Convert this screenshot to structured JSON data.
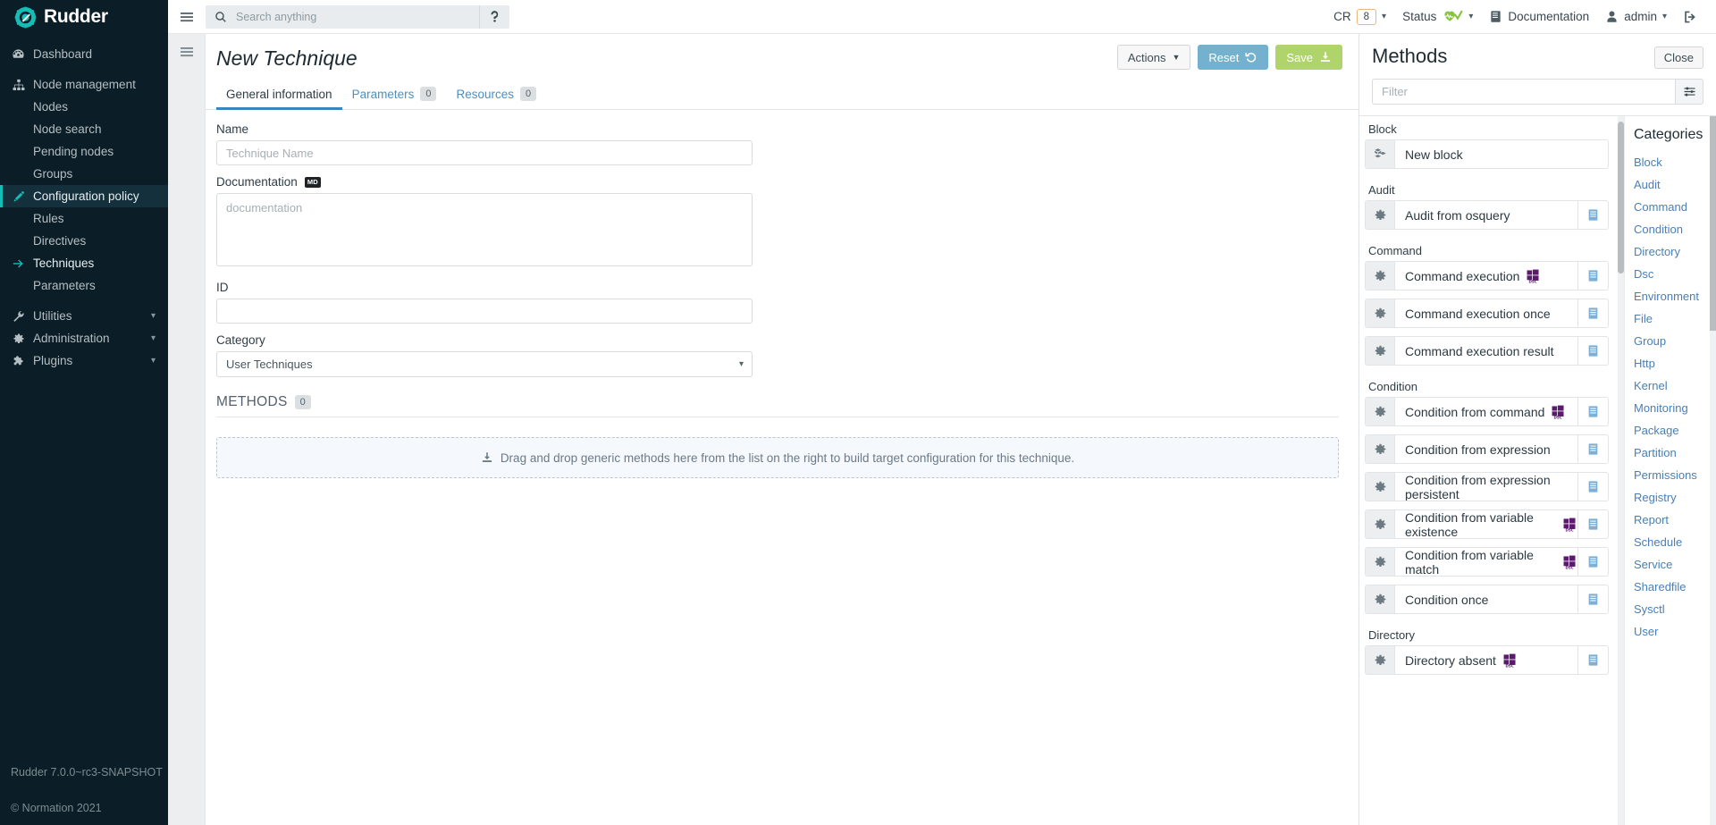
{
  "brand": {
    "name": "Rudder",
    "logo_color": "#13beb7"
  },
  "sidebar": {
    "groups": [
      {
        "label": "Dashboard",
        "icon": "dashboard-icon",
        "type": "top"
      },
      {
        "label": "Node management",
        "icon": "sitemap-icon",
        "type": "top"
      },
      {
        "label": "Nodes",
        "type": "sub"
      },
      {
        "label": "Node search",
        "type": "sub"
      },
      {
        "label": "Pending nodes",
        "type": "sub"
      },
      {
        "label": "Groups",
        "type": "sub"
      },
      {
        "label": "Configuration policy",
        "icon": "pencil-icon",
        "type": "top",
        "active": true
      },
      {
        "label": "Rules",
        "type": "sub"
      },
      {
        "label": "Directives",
        "type": "sub"
      },
      {
        "label": "Techniques",
        "type": "sub",
        "current": true,
        "icon": "arrow-right-icon"
      },
      {
        "label": "Parameters",
        "type": "sub"
      },
      {
        "label": "Utilities",
        "icon": "wrench-icon",
        "type": "top",
        "chevron": "⌄"
      },
      {
        "label": "Administration",
        "icon": "gear-icon",
        "type": "top",
        "chevron": "⌄"
      },
      {
        "label": "Plugins",
        "icon": "puzzle-icon",
        "type": "top",
        "chevron": "⌄"
      }
    ],
    "footer": {
      "version": "Rudder 7.0.0~rc3-SNAPSHOT",
      "copyright": "© Normation 2021"
    }
  },
  "topbar": {
    "search_placeholder": "Search anything",
    "search_value": "",
    "cr_label": "CR",
    "cr_count": "8",
    "status_label": "Status",
    "documentation_label": "Documentation",
    "user_label": "admin"
  },
  "page": {
    "title": "New Technique",
    "buttons": {
      "actions": "Actions",
      "reset": "Reset",
      "save": "Save"
    },
    "tabs": [
      {
        "label": "General information",
        "count": null,
        "active": true
      },
      {
        "label": "Parameters",
        "count": "0",
        "active": false
      },
      {
        "label": "Resources",
        "count": "0",
        "active": false
      }
    ],
    "form": {
      "name_label": "Name",
      "name_placeholder": "Technique Name",
      "name_value": "",
      "documentation_label": "Documentation",
      "documentation_badge": "MD",
      "documentation_placeholder": "documentation",
      "documentation_value": "",
      "id_label": "ID",
      "id_placeholder": "",
      "id_value": "",
      "category_label": "Category",
      "category_value": "User Techniques"
    },
    "methods_section": {
      "title": "METHODS",
      "count": "0",
      "dropzone_text": "Drag and drop generic methods here from the list on the right to build target configuration for this technique."
    }
  },
  "methods_panel": {
    "title": "Methods",
    "close_label": "Close",
    "filter_placeholder": "Filter",
    "filter_value": "",
    "groups": [
      {
        "category": "Block",
        "items": [
          {
            "name": "New block",
            "icon": "blocks-icon",
            "dsc": false,
            "doc": false
          }
        ]
      },
      {
        "category": "Audit",
        "items": [
          {
            "name": "Audit from osquery",
            "icon": "gear-icon",
            "dsc": false,
            "doc": true
          }
        ]
      },
      {
        "category": "Command",
        "items": [
          {
            "name": "Command execution",
            "icon": "gear-icon",
            "dsc": true,
            "doc": true
          },
          {
            "name": "Command execution once",
            "icon": "gear-icon",
            "dsc": false,
            "doc": true
          },
          {
            "name": "Command execution result",
            "icon": "gear-icon",
            "dsc": false,
            "doc": true
          }
        ]
      },
      {
        "category": "Condition",
        "items": [
          {
            "name": "Condition from command",
            "icon": "gear-icon",
            "dsc": true,
            "doc": true
          },
          {
            "name": "Condition from expression",
            "icon": "gear-icon",
            "dsc": false,
            "doc": true
          },
          {
            "name": "Condition from expression persistent",
            "icon": "gear-icon",
            "dsc": false,
            "doc": true
          },
          {
            "name": "Condition from variable existence",
            "icon": "gear-icon",
            "dsc": true,
            "doc": true
          },
          {
            "name": "Condition from variable match",
            "icon": "gear-icon",
            "dsc": true,
            "doc": true
          },
          {
            "name": "Condition once",
            "icon": "gear-icon",
            "dsc": false,
            "doc": true
          }
        ]
      },
      {
        "category": "Directory",
        "items": [
          {
            "name": "Directory absent",
            "icon": "gear-icon",
            "dsc": true,
            "doc": true
          }
        ]
      }
    ],
    "categories_title": "Categories",
    "categories": [
      "Block",
      "Audit",
      "Command",
      "Condition",
      "Directory",
      "Dsc",
      "Environment",
      "File",
      "Group",
      "Http",
      "Kernel",
      "Monitoring",
      "Package",
      "Partition",
      "Permissions",
      "Registry",
      "Report",
      "Schedule",
      "Service",
      "Sharedfile",
      "Sysctl",
      "User"
    ]
  },
  "colors": {
    "sidebar_bg": "#0b1e27",
    "accent_teal": "#13beb7",
    "save_green": "#b0d46c",
    "reset_blue": "#73b1ce",
    "tab_active_blue": "#3d85b8",
    "link_blue": "#4a7fb5",
    "dsc_purple": "#5b1a6e",
    "cr_orange": "#e8b77a"
  }
}
